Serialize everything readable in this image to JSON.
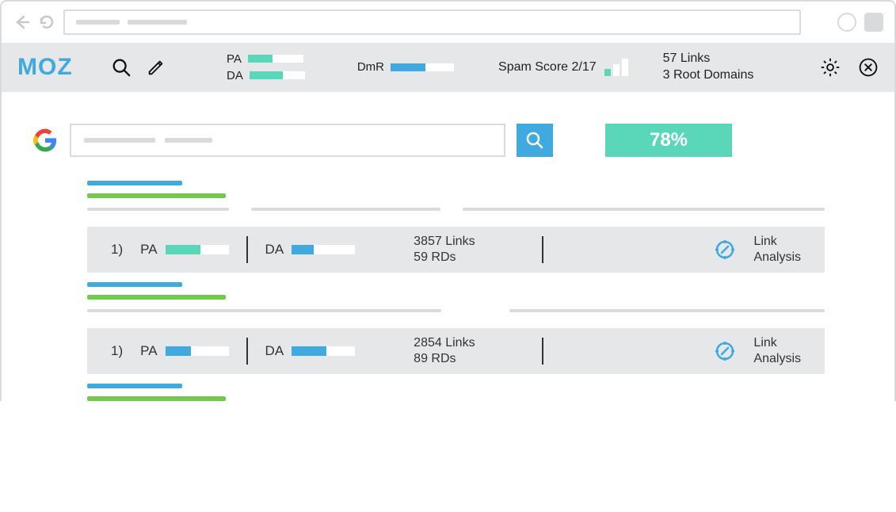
{
  "toolbar": {
    "logo": "MOZ",
    "pa_label": "PA",
    "da_label": "DA",
    "dmr_label": "DmR",
    "spam_label": "Spam Score 2/17",
    "links_line1": "57 Links",
    "links_line2": "3 Root Domains",
    "pa_fill_pct": 45,
    "da_fill_pct": 60,
    "dmr_fill_pct": 55
  },
  "search": {
    "percent_badge": "78%"
  },
  "results": [
    {
      "index_label": "1)",
      "pa_label": "PA",
      "pa_fill_pct": 55,
      "pa_color": "teal",
      "da_label": "DA",
      "da_fill_pct": 35,
      "da_color": "blue",
      "links_line1": "3857 Links",
      "links_line2": "59 RDs",
      "link_analysis_l1": "Link",
      "link_analysis_l2": "Analysis"
    },
    {
      "index_label": "1)",
      "pa_label": "PA",
      "pa_fill_pct": 40,
      "pa_color": "blue",
      "da_label": "DA",
      "da_fill_pct": 55,
      "da_color": "blue",
      "links_line1": "2854 Links",
      "links_line2": "89 RDs",
      "link_analysis_l1": "Link",
      "link_analysis_l2": "Analysis"
    }
  ]
}
